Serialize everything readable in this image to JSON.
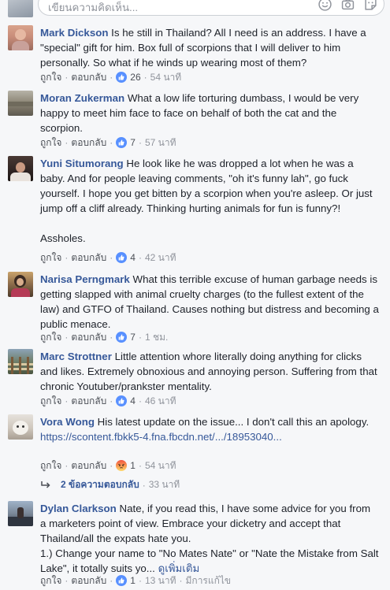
{
  "composer": {
    "placeholder": "เขียนความคิดเห็น..."
  },
  "actions": {
    "like": "ถูกใจ",
    "reply": "ตอบกลับ"
  },
  "comments": [
    {
      "author": "Mark Dickson",
      "text": "Is he still in Thailand? All I need is an address. I have a \"special\" gift for him. Box full of scorpions that I will deliver to him personally. So what if he winds up wearing most of them?",
      "reactions": [
        {
          "type": "like",
          "color": "#5890ff"
        }
      ],
      "count": "26",
      "time": "54 นาที"
    },
    {
      "author": "Moran Zukerman",
      "text": "What a low life torturing dumbass, I would be very happy to meet him face to face on behalf of both the cat and the scorpion.",
      "reactions": [
        {
          "type": "like",
          "color": "#5890ff"
        }
      ],
      "count": "7",
      "time": "57 นาที"
    },
    {
      "author": "Yuni Situmorang",
      "text": "He look like he was dropped a lot when he was a baby. And for people leaving comments, \"oh it's funny lah\", go fuck yourself. I hope you get bitten by a scorpion when you're asleep. Or just jump off a cliff already. Thinking hurting animals for fun is funny?!",
      "text2": "Assholes.",
      "reactions": [
        {
          "type": "like",
          "color": "#5890ff"
        }
      ],
      "count": "4",
      "time": "42 นาที"
    },
    {
      "author": "Narisa Perngmark",
      "text": "What this terrible excuse of human garbage needs is getting slapped with animal cruelty charges (to the fullest extent of the law) and GTFO of Thailand. Causes nothing but distress and becoming a public menace.",
      "reactions": [
        {
          "type": "like",
          "color": "#5890ff"
        }
      ],
      "count": "7",
      "time": "1 ชม."
    },
    {
      "author": "Marc Strottner",
      "text": "Little attention whore literally doing anything for clicks and likes. Extremely obnoxious and annoying person. Suffering from that chronic Youtuber/prankster mentality.",
      "reactions": [
        {
          "type": "like",
          "color": "#5890ff"
        }
      ],
      "count": "4",
      "time": "46 นาที"
    },
    {
      "author": "Vora Wong",
      "text": "His latest update on the issue... I don't call this an apology.",
      "link": "https://scontent.fbkk5-4.fna.fbcdn.net/.../18953040...",
      "reactions": [
        {
          "type": "angry",
          "color": "#f7714b"
        }
      ],
      "count": "1",
      "time": "54 นาที",
      "replies_label": "2 ข้อความตอบกลับ",
      "replies_time": "33 นาที"
    },
    {
      "author": "Dylan Clarkson",
      "text": "Nate, if you read this, I have some advice for you from a marketers point of view. Embrace your dicketry and accept that Thailand/all the expats hate you.",
      "text2": "1.) Change your name to \"No Mates Nate\" or \"Nate the Mistake from Salt Lake\", it totally suits yo...",
      "see_more": "ดูเพิ่มเติม",
      "reactions": [
        {
          "type": "like",
          "color": "#5890ff"
        }
      ],
      "count": "1",
      "time": "13 นาที",
      "edited": "มีการแก้ไข"
    }
  ]
}
